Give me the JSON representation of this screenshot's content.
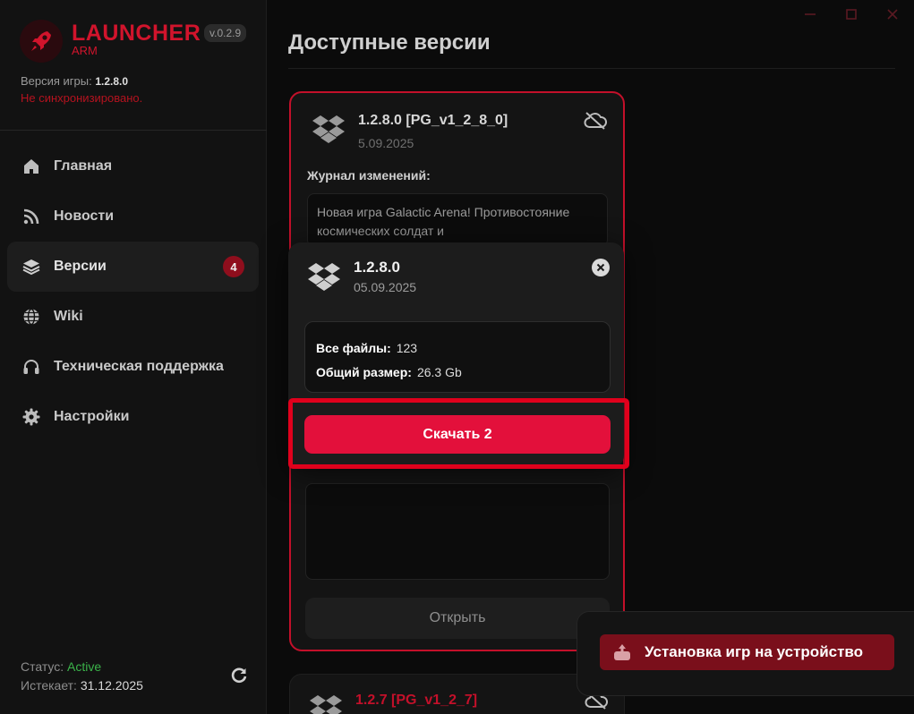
{
  "brand": {
    "title": "LAUNCHER",
    "subtitle": "ARM",
    "version_badge": "v.0.2.9"
  },
  "sidebar": {
    "game_version_label": "Версия игры:",
    "game_version_value": "1.2.8.0",
    "sync_status": "Не синхронизировано.",
    "items": [
      {
        "label": "Главная",
        "icon": "home-icon"
      },
      {
        "label": "Новости",
        "icon": "rss-icon"
      },
      {
        "label": "Версии",
        "icon": "layers-icon",
        "badge": "4",
        "active": true
      },
      {
        "label": "Wiki",
        "icon": "globe-icon"
      },
      {
        "label": "Техническая поддержка",
        "icon": "headphones-icon"
      },
      {
        "label": "Настройки",
        "icon": "gear-icon"
      }
    ],
    "status_label": "Статус:",
    "status_value": "Active",
    "expires_label": "Истекает:",
    "expires_value": "31.12.2025"
  },
  "main": {
    "page_title": "Доступные версии",
    "cards": [
      {
        "title": "1.2.8.0 [PG_v1_2_8_0]",
        "date": "5.09.2025",
        "changelog_label": "Журнал изменений:",
        "changelog_text": "Новая игра Galactic Arena! Противостояние космических солдат и",
        "lower_label": "",
        "open_button": "Открыть"
      },
      {
        "title": "1.2.7 [PG_v1_2_7]"
      }
    ]
  },
  "popup": {
    "title": "1.2.8.0",
    "date": "05.09.2025",
    "files_label": "Все файлы:",
    "files_value": "123",
    "size_label": "Общий размер:",
    "size_value": "26.3 Gb",
    "download_button": "Скачать 2"
  },
  "install_toast": {
    "button": "Установка игр на устройство"
  },
  "colors": {
    "accent": "#d1142c",
    "download": "#e3103b",
    "status_active": "#3bb34a",
    "highlight": "#e0001c"
  }
}
